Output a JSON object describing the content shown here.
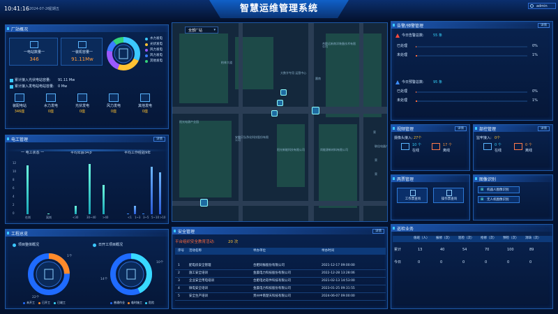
{
  "header": {
    "time": "10:41:16",
    "date": "2024-07-26",
    "weekday": "星期五",
    "title": "智慧运维管理系统",
    "user": "admin"
  },
  "station": {
    "title": "厂站概况",
    "elec_label": "一电站数量一",
    "elec_value": "346",
    "cap_label": "一装机容量一",
    "cap_value": "91.11Mw",
    "legend": [
      {
        "label": "水力发电",
        "color": "#3cc8ff"
      },
      {
        "label": "光伏发电",
        "color": "#ffc233"
      },
      {
        "label": "风力发电",
        "color": "#9b59ff"
      },
      {
        "label": "风力发电",
        "color": "#3a7cff"
      },
      {
        "label": "其他发电",
        "color": "#33d27a"
      }
    ],
    "cum1_label": "累计接入光伏电站容量:",
    "cum1_value": "91.11 Mw",
    "cum2_label": "累计接入发电站电站容量:",
    "cum2_value": "0 Mw",
    "types": [
      {
        "label": "装配电站",
        "value": "346座"
      },
      {
        "label": "水力发电",
        "value": "0座"
      },
      {
        "label": "光伏发电",
        "value": "0座"
      },
      {
        "label": "风力发电",
        "value": "0座"
      },
      {
        "label": "其他发电",
        "value": "0座"
      }
    ]
  },
  "electric": {
    "title": "电工管理",
    "btn": "详情",
    "c1_title": "一 电工状态 一",
    "c2_title": "平均年龄34岁",
    "c3_title": "平均工作经验9年",
    "c1_y": [
      "12",
      "10",
      "8",
      "6",
      "4",
      "2",
      "0"
    ],
    "c1_x": [
      "在岗",
      "离岗"
    ],
    "c2_x": [
      "<30",
      "30~40",
      ">40"
    ],
    "c3_x": [
      "<1",
      "1~3",
      "3~5",
      "5~10",
      ">10"
    ]
  },
  "engineering": {
    "title": "工程总览",
    "left_title": "项目整体概况",
    "right_title": "日开工项目概况",
    "left_labels": {
      "a": "1个",
      "b": "22个"
    },
    "right_labels": {
      "a": "10个",
      "b": "14个"
    },
    "left_legend": [
      "未开工",
      "已开工",
      "已竣工"
    ],
    "right_legend": [
      "普通作业",
      "临时施工",
      "危险"
    ]
  },
  "map": {
    "dropdown": "全部厂站",
    "labels": [
      "合肥远新南洋装备技术有限公司",
      "柏林大道",
      "大数字专用 运营中心",
      "晨南",
      "阳光电源产业园",
      "安徽贝弘净化科技股份有限公司",
      "阳光新能科技有限公司",
      "尚能源新材料有限公司",
      "荣",
      "联佳电器产业园",
      "荣",
      "荣"
    ]
  },
  "safety": {
    "title": "安全管理",
    "btn": "详情",
    "count_label": "平台组织安全教育活动:",
    "count_value": "20 次",
    "cols": [
      "序号",
      "活动名称",
      "举办单位",
      "举办时间"
    ],
    "rows": [
      [
        "1",
        "配电房安全管理",
        "合肥同振股份有限公司",
        "2021-12-17 09:00:00"
      ],
      [
        "2",
        "施工安全培训",
        "金晨电力科技股份有限公司",
        "2022-12-28 13:28:06"
      ],
      [
        "3",
        "企业安全用电培训",
        "合肥电达软件科技有限公司",
        "2021-02-13 14:53:00"
      ],
      [
        "4",
        "微电安全培训",
        "金晨电力科技股份有限公司",
        "2023-01-25 09:31:55"
      ],
      [
        "5",
        "安全生产培训",
        "贵州中南楚天科技有限公司",
        "2024-06-07 09:00:00"
      ]
    ]
  },
  "alarm": {
    "title": "告警/预警管理",
    "btn": "详情",
    "today_alarm_label": "今日告警总数:",
    "today_alarm_value": "55 条",
    "today_warn_label": "今日预警总数:",
    "today_warn_value": "95 条",
    "alarm_items": [
      {
        "label": "已处理",
        "value": "0%",
        "frac": 0
      },
      {
        "label": "未处理",
        "value": "1%",
        "frac": 0.01
      }
    ],
    "warn_items": [
      {
        "label": "已处理",
        "value": "0%",
        "frac": 0
      },
      {
        "label": "未处理",
        "value": "1%",
        "frac": 0.01
      }
    ]
  },
  "video": {
    "title": "视频管理",
    "btn": "详情",
    "access_label": "摄像头接入:",
    "access_value": "27个",
    "online_v": "10 个",
    "online_l": "在线",
    "offline_v": "17 个",
    "offline_l": "离线"
  },
  "patrol": {
    "title": "部控管理",
    "btn": "详情",
    "access_label": "监牢接入:",
    "access_value": "0个",
    "online_v": "0 个",
    "online_l": "在线",
    "offline_v": "0 个",
    "offline_l": "离线"
  },
  "ticket": {
    "title": "两票管理",
    "b1": "工作票查询",
    "b2": "操作票查询"
  },
  "image": {
    "title": "图像识别",
    "b1": "机器人图像识别",
    "b2": "无人机图像识别"
  },
  "inspection": {
    "title": "巡检业务",
    "cols": [
      "",
      "值班（人）",
      "报修（次）",
      "巡检（次）",
      "抢修（次）",
      "预检（次）",
      "消缺（次）"
    ],
    "rows": [
      [
        "累计",
        "13",
        "40",
        "54",
        "70",
        "100",
        "89"
      ],
      [
        "今日",
        "0",
        "0",
        "0",
        "0",
        "0",
        "0"
      ]
    ]
  }
}
